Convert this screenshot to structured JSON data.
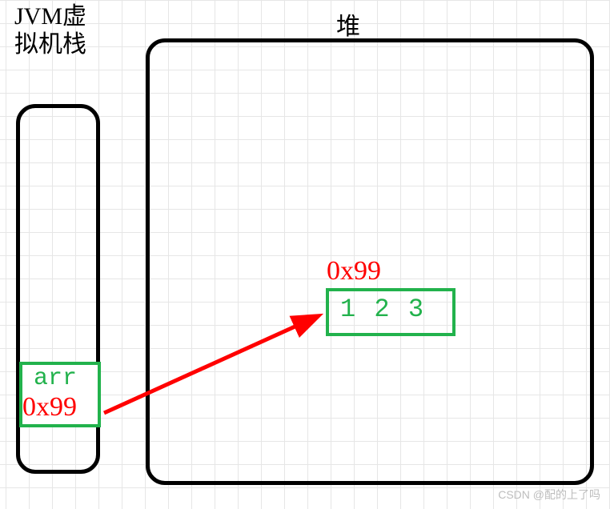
{
  "stack": {
    "title": "JVM虚\n拟机栈",
    "variable": {
      "name": "arr",
      "address": "0x99"
    }
  },
  "heap": {
    "title": "堆",
    "object": {
      "address": "0x99",
      "values": "1 2 3"
    }
  },
  "watermark": "CSDN @配的上了吗"
}
